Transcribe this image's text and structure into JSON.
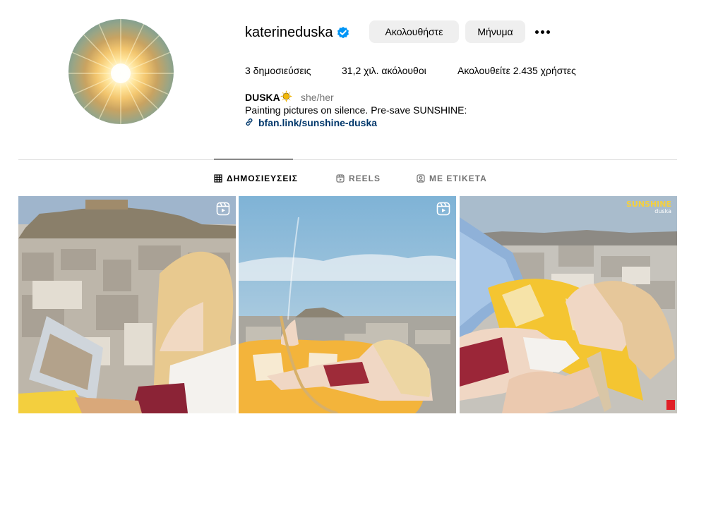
{
  "profile": {
    "username": "katerineduska",
    "verified_icon": "verified-badge-icon",
    "follow_label": "Ακολουθήστε",
    "message_label": "Μήνυμα"
  },
  "stats": {
    "posts": "3 δημοσιεύσεις",
    "followers": "31,2 χιλ. ακόλουθοι",
    "following": "Ακολουθείτε 2.435 χρήστες"
  },
  "bio": {
    "name": "DUSKA",
    "pronouns": "she/her",
    "text": "Painting pictures on silence. Pre-save SUNSHINE:",
    "link": "bfan.link/sunshine-duska"
  },
  "tabs": [
    {
      "label": "ΔΗΜΟΣΙΕΥΣΕΙΣ",
      "icon": "grid-icon",
      "active": true
    },
    {
      "label": "REELS",
      "icon": "reels-icon",
      "active": false
    },
    {
      "label": "ΜΕ ΕΤΙΚΕΤΑ",
      "icon": "tagged-icon",
      "active": false
    }
  ],
  "posts": [
    {
      "type": "reel",
      "icon": "reel-badge-icon"
    },
    {
      "type": "reel",
      "icon": "reel-badge-icon"
    },
    {
      "type": "image",
      "overlay_title": "SUNSHINE",
      "overlay_subtitle": "duska"
    }
  ],
  "colors": {
    "verified": "#0095f6",
    "button_bg": "#efefef",
    "link": "#00376b",
    "secondary_text": "#737373",
    "divider": "#dbdbdb"
  }
}
